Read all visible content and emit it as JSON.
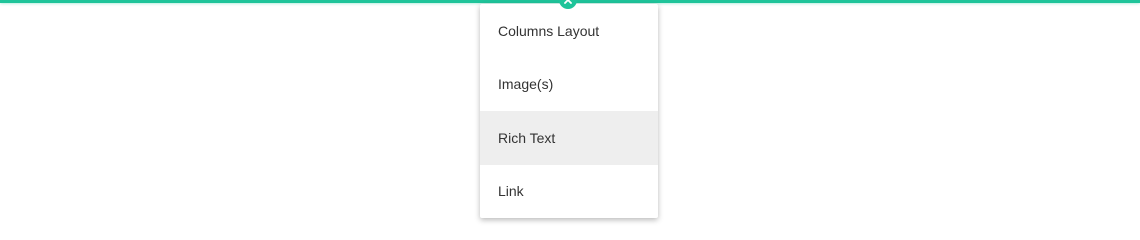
{
  "insert_line": {
    "color": "#1fc49a"
  },
  "close_button": {
    "icon": "close-icon",
    "color": "#1fc49a"
  },
  "menu": {
    "highlight_color": "#eeeeee",
    "items": [
      {
        "label": "Columns Layout",
        "highlighted": false
      },
      {
        "label": "Image(s)",
        "highlighted": false
      },
      {
        "label": "Rich Text",
        "highlighted": true
      },
      {
        "label": "Link",
        "highlighted": false
      }
    ]
  }
}
